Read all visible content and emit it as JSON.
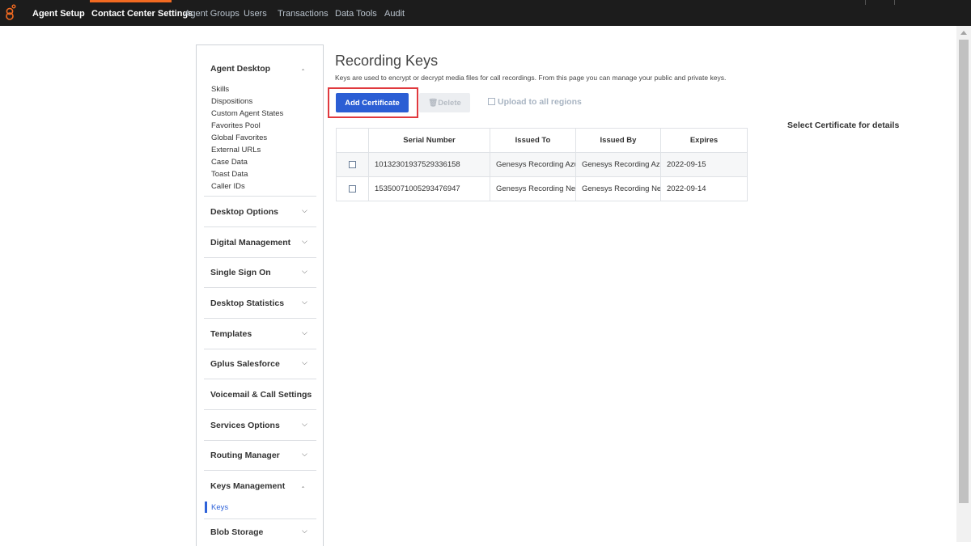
{
  "topnav": {
    "items": [
      {
        "label": "Agent Setup"
      },
      {
        "label": "Contact Center Settings"
      },
      {
        "label": "Agent Groups"
      },
      {
        "label": "Users"
      },
      {
        "label": "Transactions"
      },
      {
        "label": "Data Tools"
      },
      {
        "label": "Audit"
      }
    ],
    "active": "Contact Center Settings",
    "active_color": "#f26a21",
    "background": "#1c1c1c"
  },
  "sidebar": {
    "agent_desktop": {
      "label": "Agent Desktop",
      "expanded": true,
      "items": [
        "Skills",
        "Dispositions",
        "Custom Agent States",
        "Favorites Pool",
        "Global Favorites",
        "External URLs",
        "Case Data",
        "Toast Data",
        "Caller IDs"
      ]
    },
    "sections": [
      {
        "label": "Desktop Options",
        "expanded": false
      },
      {
        "label": "Digital Management",
        "expanded": false
      },
      {
        "label": "Single Sign On",
        "expanded": false
      },
      {
        "label": "Desktop Statistics",
        "expanded": false
      },
      {
        "label": "Templates",
        "expanded": false
      },
      {
        "label": "Gplus Salesforce",
        "expanded": false
      },
      {
        "label": "Voicemail & Call Settings",
        "expanded": false
      },
      {
        "label": "Services Options",
        "expanded": false
      },
      {
        "label": "Routing Manager",
        "expanded": false
      }
    ],
    "keys_management": {
      "label": "Keys Management",
      "expanded": true,
      "items": [
        "Keys"
      ],
      "selected": "Keys"
    },
    "blob_storage": {
      "label": "Blob Storage",
      "expanded": false
    }
  },
  "main": {
    "title": "Recording Keys",
    "description": "Keys are used to encrypt or decrypt media files for call recordings. From this page you can manage your public and private keys.",
    "add_button": "Add Certificate",
    "delete_button": "Delete",
    "upload_label": "Upload to all regions",
    "details_hint": "Select Certificate for details",
    "accent_color": "#2b5ed4",
    "highlight_color": "#e0393e",
    "table": {
      "headers": [
        "Serial Number",
        "Issued To",
        "Issued By",
        "Expires"
      ],
      "rows": [
        {
          "serial": "10132301937529336158",
          "issued_to": "Genesys Recording Azu",
          "issued_by": "Genesys Recording Azu",
          "expires": "2022-09-15"
        },
        {
          "serial": "15350071005293476947",
          "issued_to": "Genesys Recording New",
          "issued_by": "Genesys Recording New",
          "expires": "2022-09-14"
        }
      ]
    }
  }
}
